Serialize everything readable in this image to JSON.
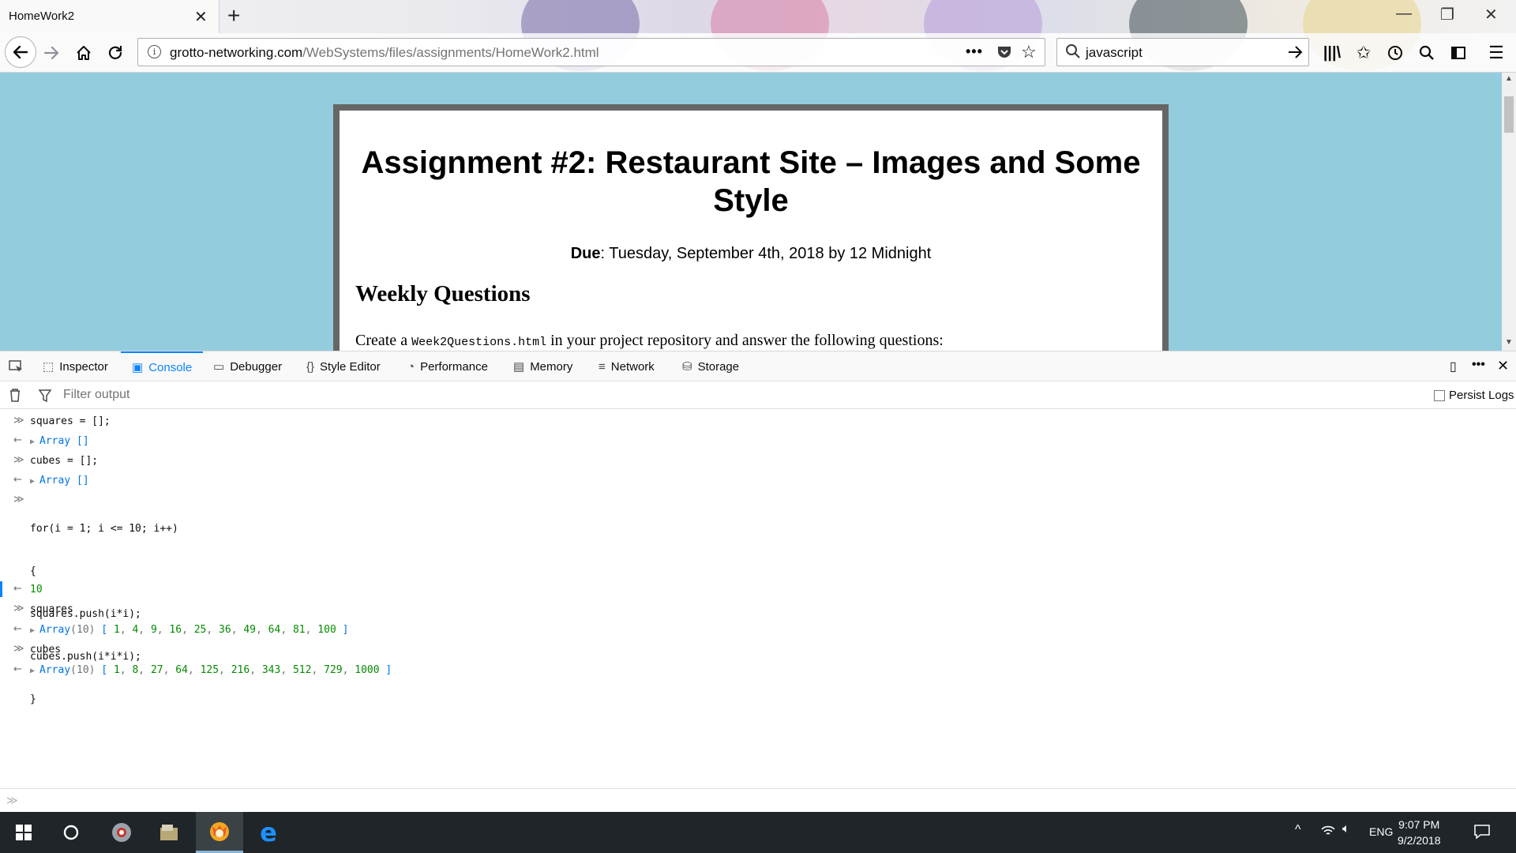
{
  "browser": {
    "tab_title": "HomeWork2",
    "url_host": "grotto-networking.com",
    "url_path": "/WebSystems/files/assignments/HomeWork2.html",
    "search_value": "javascript"
  },
  "page": {
    "title": "Assignment #2: Restaurant Site – Images and Some Style",
    "due_label": "Due",
    "due_text": ": Tuesday, September 4th, 2018 by 12 Midnight",
    "weekly_heading": "Weekly Questions",
    "create_prefix": "Create a ",
    "create_code": "Week2Questions.html",
    "create_suffix": " in your project repository and answer the following questions:"
  },
  "devtools": {
    "tabs": [
      {
        "label": "Inspector",
        "icon": "inspector-icon"
      },
      {
        "label": "Console",
        "icon": "console-icon"
      },
      {
        "label": "Debugger",
        "icon": "debugger-icon"
      },
      {
        "label": "Style Editor",
        "icon": "style-editor-icon"
      },
      {
        "label": "Performance",
        "icon": "performance-icon"
      },
      {
        "label": "Memory",
        "icon": "memory-icon"
      },
      {
        "label": "Network",
        "icon": "network-icon"
      },
      {
        "label": "Storage",
        "icon": "storage-icon"
      }
    ],
    "active_tab": "Console",
    "filter_placeholder": "Filter output",
    "persist_logs": "Persist Logs",
    "persist_checked": false
  },
  "console": {
    "cmd1": "squares = [];",
    "res1_obj": "Array",
    "res1_val": " []",
    "cmd2": "cubes = [];",
    "res2_obj": "Array",
    "res2_val": " []",
    "cmd3_line1": "for(i = 1; i <= 10; i++)",
    "cmd3_line2": "{",
    "cmd3_line3": "squares.push(i*i);",
    "cmd3_line4": "cubes.push(i*i*i);",
    "cmd3_line5": "}",
    "res3": "10",
    "cmd4": "squares",
    "res4_obj": "Array",
    "res4_len": "(10)",
    "res4_values": [
      "1",
      "4",
      "9",
      "16",
      "25",
      "36",
      "49",
      "64",
      "81",
      "100"
    ],
    "cmd5": "cubes",
    "res5_obj": "Array",
    "res5_len": "(10)",
    "res5_values": [
      "1",
      "8",
      "27",
      "64",
      "125",
      "216",
      "343",
      "512",
      "729",
      "1000"
    ]
  },
  "taskbar": {
    "language": "ENG",
    "time": "9:07 PM",
    "date": "9/2/2018"
  }
}
